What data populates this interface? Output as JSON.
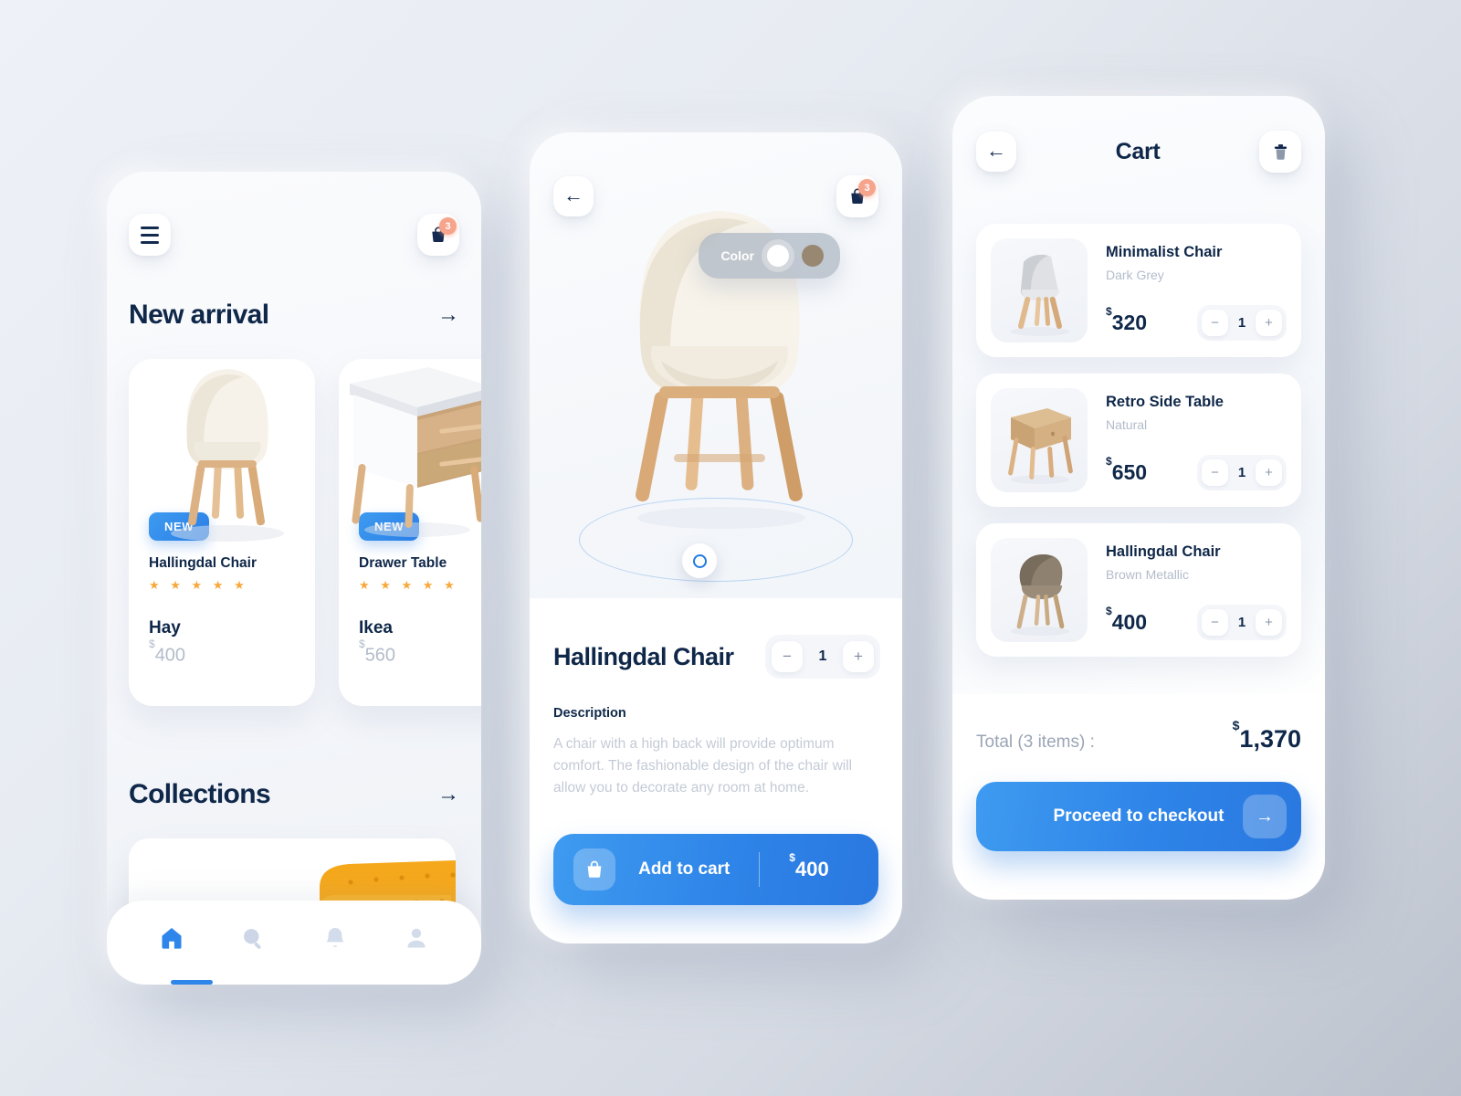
{
  "home": {
    "menu_icon": "hamburger-menu-icon",
    "cart_icon": "shopping-bag-icon",
    "cart_badge": "3",
    "new_arrival": {
      "title": "New arrival",
      "arrow": "→"
    },
    "products": [
      {
        "tag": "NEW",
        "name": "Hallingdal Chair",
        "stars": "★ ★ ★ ★ ★",
        "brand": "Hay",
        "currency": "$",
        "price": "400"
      },
      {
        "tag": "NEW",
        "name": "Drawer Table",
        "stars": "★ ★ ★ ★ ★",
        "brand": "Ikea",
        "currency": "$",
        "price": "560"
      }
    ],
    "collections": {
      "title": "Collections",
      "arrow": "→"
    },
    "tabs": [
      {
        "name": "home",
        "icon": "home-icon",
        "active": true
      },
      {
        "name": "search",
        "icon": "search-icon",
        "active": false
      },
      {
        "name": "notifications",
        "icon": "bell-icon",
        "active": false
      },
      {
        "name": "profile",
        "icon": "user-icon",
        "active": false
      }
    ]
  },
  "detail": {
    "back_icon": "arrow-left-icon",
    "cart_icon": "shopping-bag-icon",
    "cart_badge": "3",
    "color_label": "Color",
    "colors": [
      {
        "name": "white",
        "hex": "#ffffff",
        "selected": true
      },
      {
        "name": "brown",
        "hex": "#998871",
        "selected": false
      }
    ],
    "rotate_handle": "rotate-360-handle",
    "title": "Hallingdal Chair",
    "quantity": "1",
    "minus": "−",
    "plus": "+",
    "description_label": "Description",
    "description": "A chair with a high back will provide optimum comfort. The fashionable design of the chair will allow you to decorate any room at home.",
    "cta_label": "Add to cart",
    "cta_icon": "shopping-bag-icon",
    "cta_currency": "$",
    "cta_price": "400"
  },
  "cart": {
    "back_icon": "arrow-left-icon",
    "title": "Cart",
    "delete_icon": "trash-icon",
    "items": [
      {
        "name": "Minimalist Chair",
        "variant": "Dark Grey",
        "currency": "$",
        "price": "320",
        "quantity": "1",
        "minus": "−",
        "plus": "+"
      },
      {
        "name": "Retro Side Table",
        "variant": "Natural",
        "currency": "$",
        "price": "650",
        "quantity": "1",
        "minus": "−",
        "plus": "+"
      },
      {
        "name": "Hallingdal Chair",
        "variant": "Brown Metallic",
        "currency": "$",
        "price": "400",
        "quantity": "1",
        "minus": "−",
        "plus": "+"
      }
    ],
    "total_label": "Total (3 items) :",
    "total_currency": "$",
    "total_value": "1,370",
    "checkout_label": "Proceed to checkout",
    "checkout_arrow": "→"
  },
  "colors": {
    "accent": "#2e84e8",
    "navy": "#0f2749",
    "star": "#f7a83a",
    "badge": "#f6a48c",
    "muted": "#b3bccb"
  }
}
